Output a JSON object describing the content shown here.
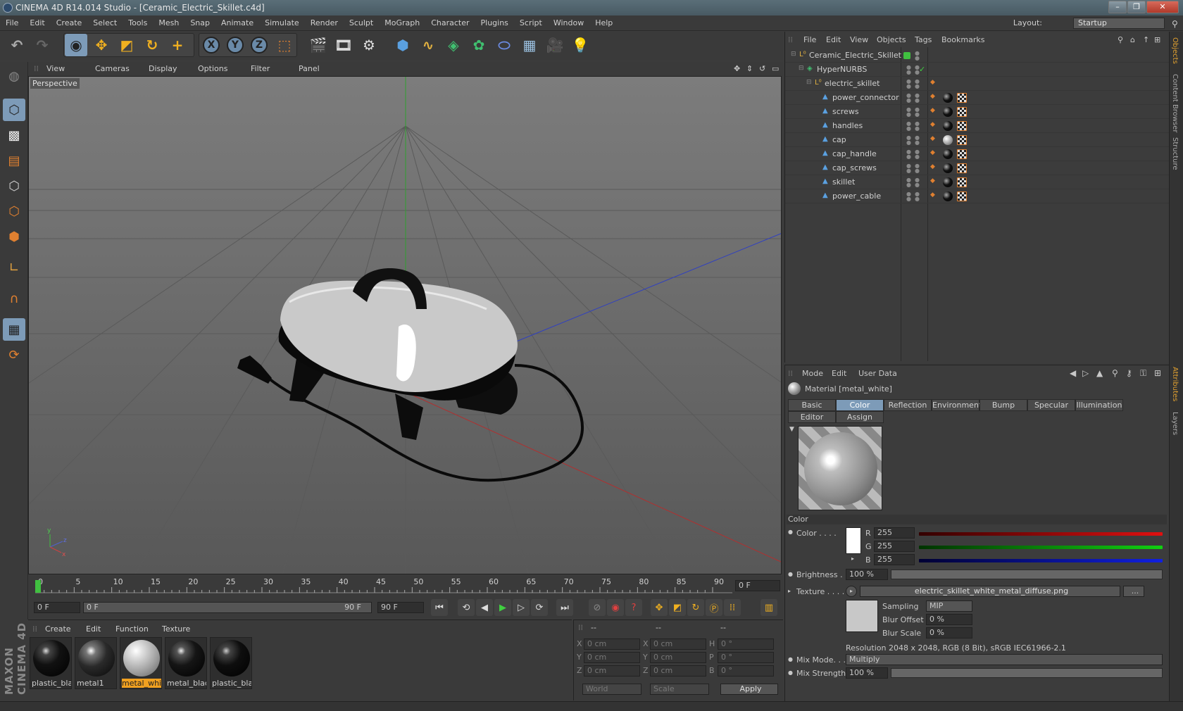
{
  "window": {
    "title": "CINEMA 4D R14.014 Studio - [Ceramic_Electric_Skillet.c4d]",
    "minimize": "–",
    "maximize": "❐",
    "close": "✕"
  },
  "menu": [
    "File",
    "Edit",
    "Create",
    "Select",
    "Tools",
    "Mesh",
    "Snap",
    "Animate",
    "Simulate",
    "Render",
    "Sculpt",
    "MoGraph",
    "Character",
    "Plugins",
    "Script",
    "Window",
    "Help"
  ],
  "layout": {
    "label": "Layout:",
    "value": "Startup"
  },
  "viewport": {
    "menu": [
      "View",
      "Cameras",
      "Display",
      "Options",
      "Filter",
      "Panel"
    ],
    "label": "Perspective",
    "axis_x": "x",
    "axis_y": "y",
    "axis_z": "z"
  },
  "timeline": {
    "ticks": [
      "0",
      "5",
      "10",
      "15",
      "20",
      "25",
      "30",
      "35",
      "40",
      "45",
      "50",
      "55",
      "60",
      "65",
      "70",
      "75",
      "80",
      "85",
      "90"
    ],
    "current_frame": "0 F"
  },
  "transport": {
    "start": "0 F",
    "slider_left": "0 F",
    "slider_right": "90 F",
    "end": "90 F"
  },
  "materials": {
    "menu": [
      "Create",
      "Edit",
      "Function",
      "Texture"
    ],
    "items": [
      {
        "name": "plastic_bla",
        "selected": false,
        "color": "#111111"
      },
      {
        "name": "metal1",
        "selected": false,
        "color": "#2a2a2a"
      },
      {
        "name": "metal_whit",
        "selected": true,
        "color": "#cfcfcf"
      },
      {
        "name": "metal_blacl",
        "selected": false,
        "color": "#151515"
      },
      {
        "name": "plastic_bla",
        "selected": false,
        "color": "#0e0e0e"
      }
    ]
  },
  "coords": {
    "headers": [
      "--",
      "--",
      "--"
    ],
    "rows": [
      {
        "a": "X",
        "av": "0 cm",
        "b": "X",
        "bv": "0 cm",
        "c": "H",
        "cv": "0 °"
      },
      {
        "a": "Y",
        "av": "0 cm",
        "b": "Y",
        "bv": "0 cm",
        "c": "P",
        "cv": "0 °"
      },
      {
        "a": "Z",
        "av": "0 cm",
        "b": "Z",
        "bv": "0 cm",
        "c": "B",
        "cv": "0 °"
      }
    ],
    "world": "World",
    "scale": "Scale",
    "apply": "Apply"
  },
  "objects": {
    "menu": [
      "File",
      "Edit",
      "View",
      "Objects",
      "Tags",
      "Bookmarks"
    ],
    "rows": [
      {
        "name": "Ceramic_Electric_Skillet",
        "depth": 0,
        "icon": "null-icon",
        "tags": "layer"
      },
      {
        "name": "HyperNURBS",
        "depth": 1,
        "icon": "hypernurbs-icon",
        "tags": "check"
      },
      {
        "name": "electric_skillet",
        "depth": 2,
        "icon": "null-icon",
        "tags": "phong"
      },
      {
        "name": "power_connector",
        "depth": 3,
        "icon": "polygon-icon",
        "tags": "full"
      },
      {
        "name": "screws",
        "depth": 3,
        "icon": "polygon-icon",
        "tags": "full"
      },
      {
        "name": "handles",
        "depth": 3,
        "icon": "polygon-icon",
        "tags": "full"
      },
      {
        "name": "cap",
        "depth": 3,
        "icon": "polygon-icon",
        "tags": "white"
      },
      {
        "name": "cap_handle",
        "depth": 3,
        "icon": "polygon-icon",
        "tags": "full"
      },
      {
        "name": "cap_screws",
        "depth": 3,
        "icon": "polygon-icon",
        "tags": "full"
      },
      {
        "name": "skillet",
        "depth": 3,
        "icon": "polygon-icon",
        "tags": "full"
      },
      {
        "name": "power_cable",
        "depth": 3,
        "icon": "polygon-icon",
        "tags": "full"
      }
    ]
  },
  "attributes": {
    "menu": [
      "Mode",
      "Edit",
      "User Data"
    ],
    "material_title": "Material [metal_white]",
    "tabs_row1": [
      "Basic",
      "Color",
      "Reflection",
      "Environment",
      "Bump",
      "Specular",
      "Illumination"
    ],
    "tabs_row2": [
      "Editor",
      "Assign"
    ],
    "active_tab": "Color",
    "section": "Color",
    "color_label": "Color . . . .",
    "r_label": "R",
    "r_value": "255",
    "g_label": "G",
    "g_value": "255",
    "b_label": "B",
    "b_value": "255",
    "brightness_label": "Brightness . .",
    "brightness_value": "100 %",
    "texture_label": "Texture . . . .",
    "texture_file": "electric_skillet_white_metal_diffuse.png",
    "texture_more": "...",
    "sampling_label": "Sampling",
    "sampling_value": "MIP",
    "blur_offset_label": "Blur Offset",
    "blur_offset_value": "0 %",
    "blur_scale_label": "Blur Scale",
    "blur_scale_value": "0 %",
    "resolution": "Resolution 2048 x 2048, RGB (8 Bit), sRGB IEC61966-2.1",
    "mix_mode_label": "Mix Mode. . .",
    "mix_mode_value": "Multiply",
    "mix_strength_label": "Mix Strength",
    "mix_strength_value": "100 %"
  },
  "side_tabs": [
    "Objects",
    "Content Browser",
    "Structure",
    "Attributes",
    "Layers"
  ],
  "brand": "MAXON CINEMA 4D"
}
